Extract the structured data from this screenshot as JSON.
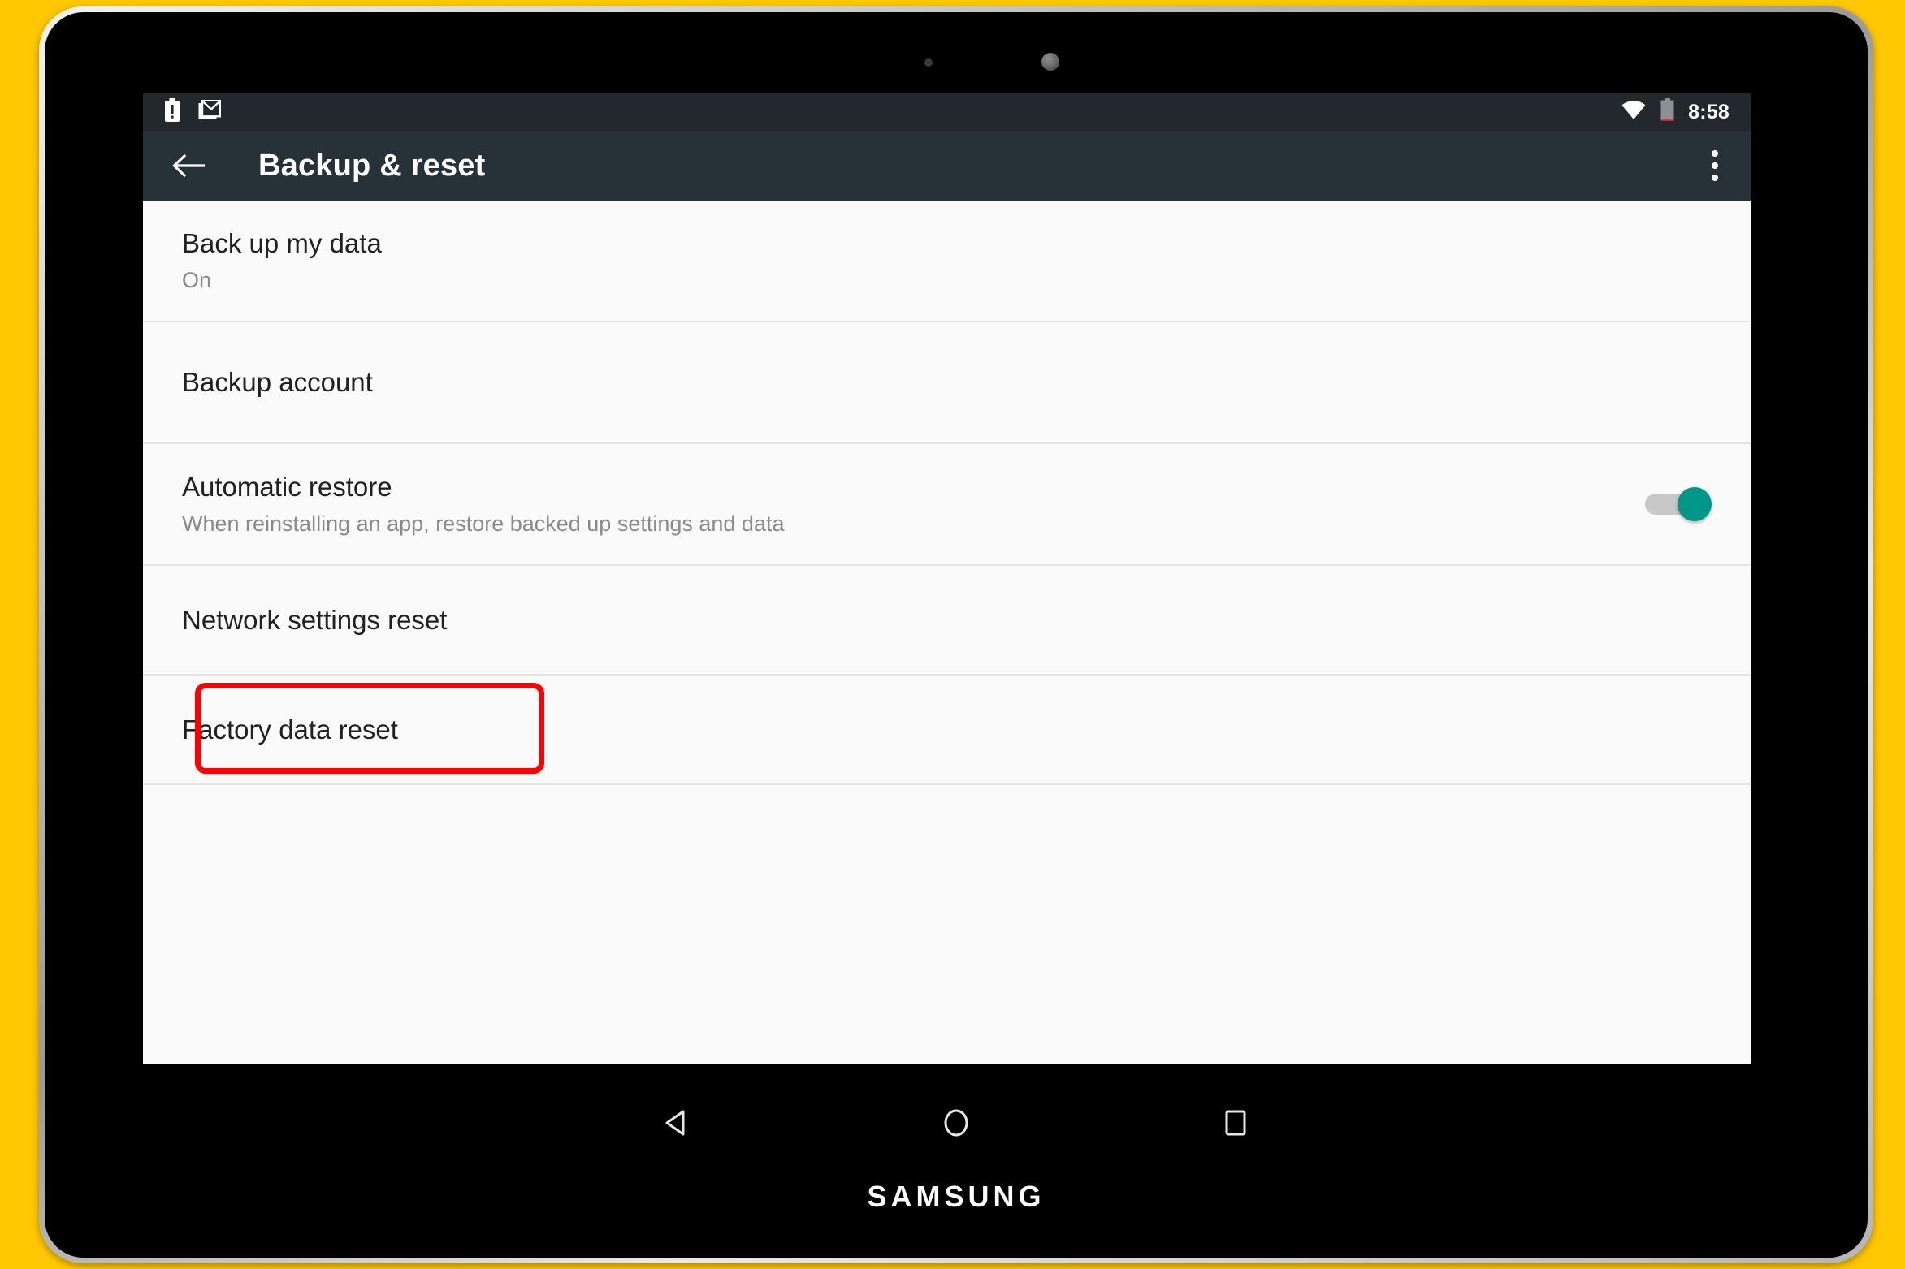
{
  "device": {
    "brand": "SAMSUNG"
  },
  "statusbar": {
    "time": "8:58",
    "icons": {
      "battery_alert": "battery-alert-icon",
      "mail": "gmail-icon",
      "wifi": "wifi-icon",
      "battery": "battery-low-icon"
    }
  },
  "toolbar": {
    "title": "Backup & reset",
    "back_icon": "back-arrow-icon",
    "overflow_icon": "overflow-menu-icon"
  },
  "settings": {
    "rows": [
      {
        "title": "Back up my data",
        "subtitle": "On",
        "has_switch": false,
        "highlighted": false
      },
      {
        "title": "Backup account",
        "subtitle": "",
        "has_switch": false,
        "highlighted": false
      },
      {
        "title": "Automatic restore",
        "subtitle": "When reinstalling an app, restore backed up settings and data",
        "has_switch": true,
        "switch_on": true,
        "highlighted": false
      },
      {
        "title": "Network settings reset",
        "subtitle": "",
        "has_switch": false,
        "highlighted": false
      },
      {
        "title": "Factory data reset",
        "subtitle": "",
        "has_switch": false,
        "highlighted": true
      }
    ]
  },
  "navbar": {
    "back": "nav-back-icon",
    "home": "nav-home-icon",
    "recents": "nav-recents-icon"
  },
  "colors": {
    "backdrop": "#FFC800",
    "statusbar": "#23282C",
    "toolbar": "#263238",
    "panel": "#FAFAFA",
    "switch_on": "#009688",
    "annotation": "#FF0000"
  }
}
